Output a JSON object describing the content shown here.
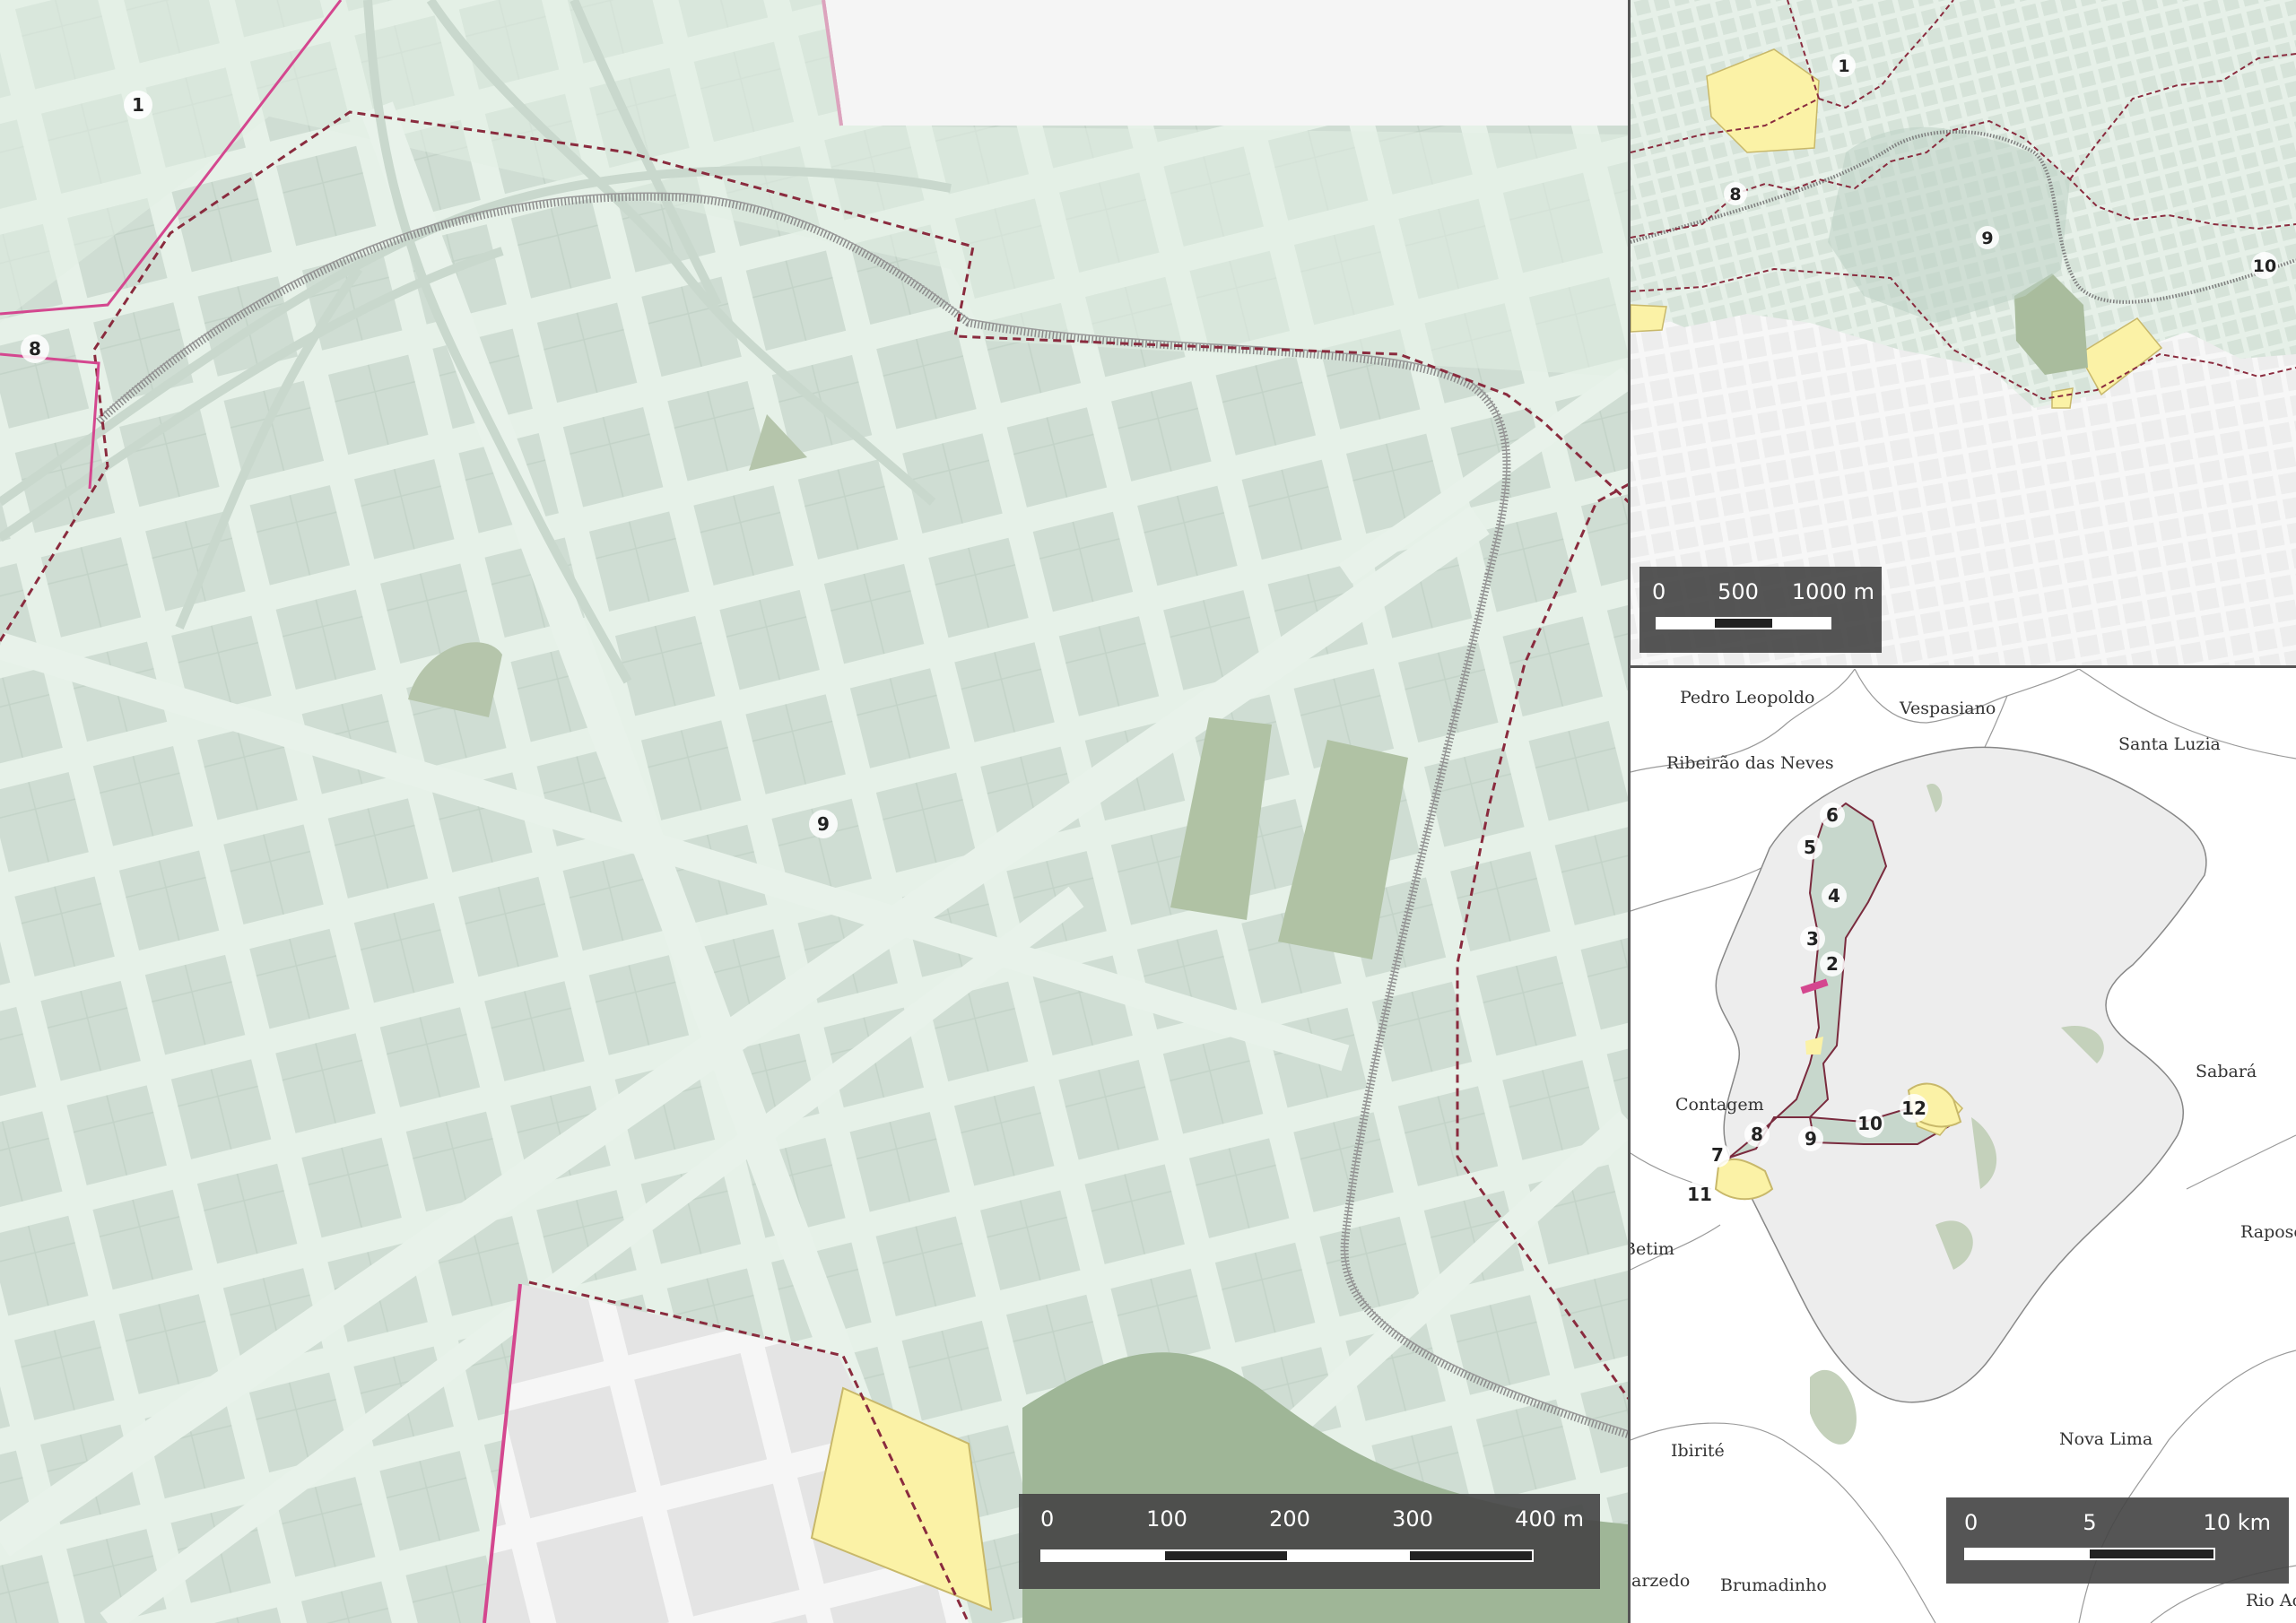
{
  "main_map": {
    "zone_labels": [
      "1",
      "8",
      "9"
    ],
    "scale": {
      "ticks": [
        "0",
        "100",
        "200",
        "300",
        "400 m"
      ]
    }
  },
  "overview_map": {
    "zone_labels": [
      "1",
      "8",
      "9",
      "10"
    ],
    "scale": {
      "ticks": [
        "0",
        "500",
        "1000 m"
      ]
    }
  },
  "region_map": {
    "zone_labels": [
      "2",
      "3",
      "4",
      "5",
      "6",
      "7",
      "8",
      "9",
      "10",
      "11",
      "12"
    ],
    "municipalities": [
      "Pedro Leopoldo",
      "Vespasiano",
      "Santa Luzia",
      "Ribeirão das Neves",
      "Contagem",
      "Sabará",
      "Betim",
      "Raposos",
      "Ibirité",
      "Nova Lima",
      "Sarzedo",
      "Brumadinho",
      "Rio Acima"
    ],
    "scale": {
      "ticks": [
        "0",
        "5",
        "10 km"
      ]
    }
  },
  "colors": {
    "zone_fill": "#dfece2",
    "block_fill": "#cfddd3",
    "street": "#e8f2ea",
    "park": "#a9bc9d",
    "highlight": "#fbf2a6",
    "boundary": "#8a2b3e",
    "municipal_boundary": "#d4478f",
    "outside_fill": "#f4f4f4",
    "scalebar_bg": "#464646"
  }
}
